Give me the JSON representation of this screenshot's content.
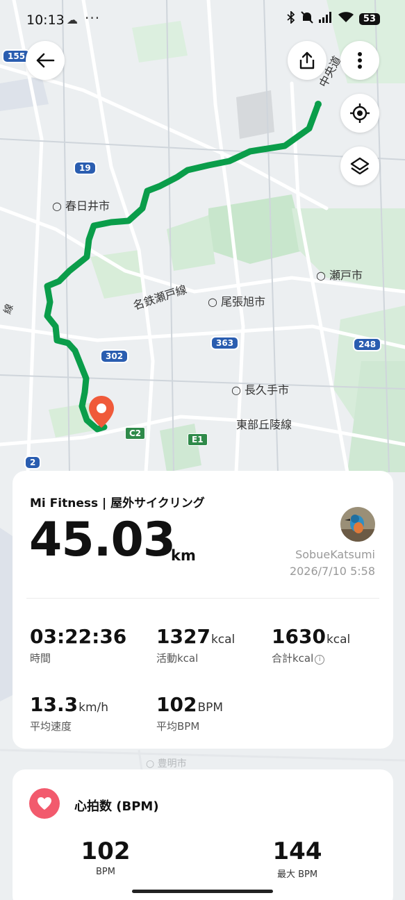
{
  "status_bar": {
    "time": "10:13",
    "battery": "53",
    "icons": [
      "cloud-icon",
      "more-dots-icon",
      "bluetooth-icon",
      "mute-icon",
      "signal-icon",
      "wifi-icon",
      "battery-icon"
    ]
  },
  "map": {
    "labels": [
      "春日井市",
      "瀬戸市",
      "尾張旭市",
      "名鉄瀬戸線",
      "長久手市",
      "東部丘陵線",
      "中央道",
      "豊明市",
      "線"
    ],
    "route_shields": [
      "155",
      "19",
      "302",
      "363",
      "248",
      "2"
    ],
    "expressway_shields": [
      "C2",
      "E1"
    ],
    "colors": {
      "route": "#0a9d4a",
      "marker": "#f05a3a",
      "park": "#c8e6cc",
      "road": "#ffffff",
      "water": "#d6dbe3"
    },
    "buttons": [
      "back-arrow-icon",
      "share-icon",
      "more-vert-icon",
      "locate-icon",
      "layers-icon"
    ]
  },
  "summary": {
    "title": "Mi Fitness | 屋外サイクリング",
    "distance": "45.03",
    "distance_unit": "km",
    "user": "SobueKatsumi",
    "date": "2026/7/10 5:58",
    "stats": [
      {
        "value": "03:22:36",
        "unit": "",
        "label": "時間"
      },
      {
        "value": "1327",
        "unit": "kcal",
        "label": "活動kcal"
      },
      {
        "value": "1630",
        "unit": "kcal",
        "label": "合計kcal"
      },
      {
        "value": "13.3",
        "unit": "km/h",
        "label": "平均速度"
      },
      {
        "value": "102",
        "unit": "BPM",
        "label": "平均BPM"
      }
    ]
  },
  "heart_rate": {
    "title": "心拍数 (BPM)",
    "items": [
      {
        "value": "102",
        "label": "BPM"
      },
      {
        "value": "144",
        "label": "最大 BPM"
      }
    ]
  }
}
